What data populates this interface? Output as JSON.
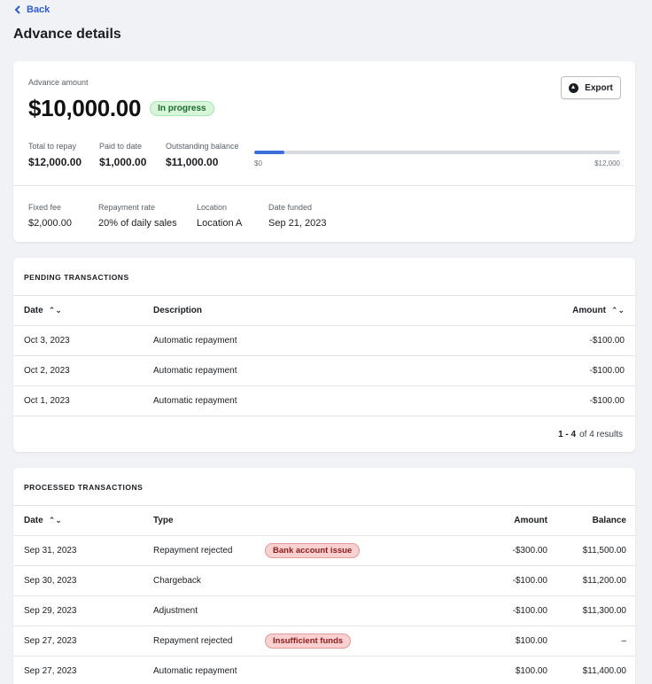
{
  "nav": {
    "back_label": "Back"
  },
  "page": {
    "title": "Advance details"
  },
  "summary": {
    "amount_label": "Advance amount",
    "amount": "$10,000.00",
    "status": "In progress",
    "export_label": "Export",
    "stats": [
      {
        "label": "Total to repay",
        "value": "$12,000.00"
      },
      {
        "label": "Paid to date",
        "value": "$1,000.00"
      },
      {
        "label": "Outstanding balance",
        "value": "$11,000.00"
      }
    ],
    "progress": {
      "fraction": 0.083,
      "min_label": "$0",
      "max_label": "$12,000"
    },
    "details": [
      {
        "label": "Fixed fee",
        "value": "$2,000.00"
      },
      {
        "label": "Repayment rate",
        "value": "20% of daily sales"
      },
      {
        "label": "Location",
        "value": "Location A"
      },
      {
        "label": "Date funded",
        "value": "Sep 21, 2023"
      }
    ]
  },
  "pending": {
    "title": "PENDING TRANSACTIONS",
    "columns": {
      "date": "Date",
      "description": "Description",
      "amount": "Amount"
    },
    "rows": [
      {
        "date": "Oct 3, 2023",
        "description": "Automatic repayment",
        "amount": "-$100.00"
      },
      {
        "date": "Oct 2, 2023",
        "description": "Automatic repayment",
        "amount": "-$100.00"
      },
      {
        "date": "Oct 1, 2023",
        "description": "Automatic repayment",
        "amount": "-$100.00"
      }
    ],
    "results_range": "1 - 4",
    "results_total": "of 4 results"
  },
  "processed": {
    "title": "PROCESSED TRANSACTIONS",
    "columns": {
      "date": "Date",
      "type": "Type",
      "amount": "Amount",
      "balance": "Balance"
    },
    "rows": [
      {
        "date": "Sep 31, 2023",
        "type": "Repayment rejected",
        "badge": "Bank account issue",
        "amount": "-$300.00",
        "balance": "$11,500.00"
      },
      {
        "date": "Sep 30, 2023",
        "type": "Chargeback",
        "badge": "",
        "amount": "-$100.00",
        "balance": "$11,200.00"
      },
      {
        "date": "Sep 29, 2023",
        "type": "Adjustment",
        "badge": "",
        "amount": "-$100.00",
        "balance": "$11,300.00"
      },
      {
        "date": "Sep 27, 2023",
        "type": "Repayment rejected",
        "badge": "Insufficient funds",
        "amount": "$100.00",
        "balance": "–"
      },
      {
        "date": "Sep 27, 2023",
        "type": "Automatic repayment",
        "badge": "",
        "amount": "$100.00",
        "balance": "$11,400.00"
      }
    ]
  },
  "icons": {
    "back": "chevron-left-icon",
    "export": "upload-icon",
    "sort": "sort-icon"
  },
  "colors": {
    "accent": "#2f5bd3",
    "progress_fill": "#3a6fd8",
    "status_green": "#d6f5d9",
    "error_red": "#fbd0d0"
  }
}
